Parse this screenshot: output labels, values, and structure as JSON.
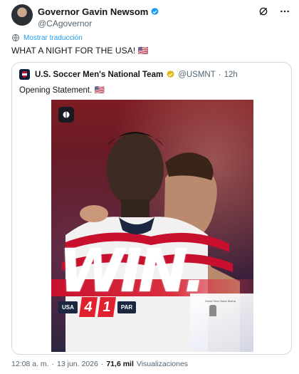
{
  "author": {
    "name": "Governor Gavin Newsom",
    "handle": "@CAgovernor"
  },
  "translate_label": "Mostrar traducción",
  "tweet_text": "WHAT A NIGHT FOR THE USA! 🇺🇸",
  "quote": {
    "name": "U.S. Soccer Men's National Team",
    "handle": "@USMNT",
    "separator": "·",
    "time": "12h",
    "text": "Opening Statement. 🇺🇸"
  },
  "media": {
    "headline": "WIN.",
    "home_team": "USA",
    "home_score": "4",
    "away_score": "1",
    "away_team": "PAR",
    "fine_print": "Serve Vinci Nasa Motha"
  },
  "footer": {
    "time": "12:08 a. m.",
    "dot1": "·",
    "date": "13 jun. 2026",
    "dot2": "·",
    "views": "71,6 mil",
    "views_label": "Visualizaciones"
  },
  "colors": {
    "verified_blue": "#1d9bf0",
    "gold_check": "#e2b719",
    "accent_red": "#c8102e",
    "navy": "#1b2741"
  },
  "icons": [
    "verified-icon",
    "grok-icon",
    "more-icon",
    "globe-icon",
    "gold-verified-icon",
    "crest-icon"
  ]
}
